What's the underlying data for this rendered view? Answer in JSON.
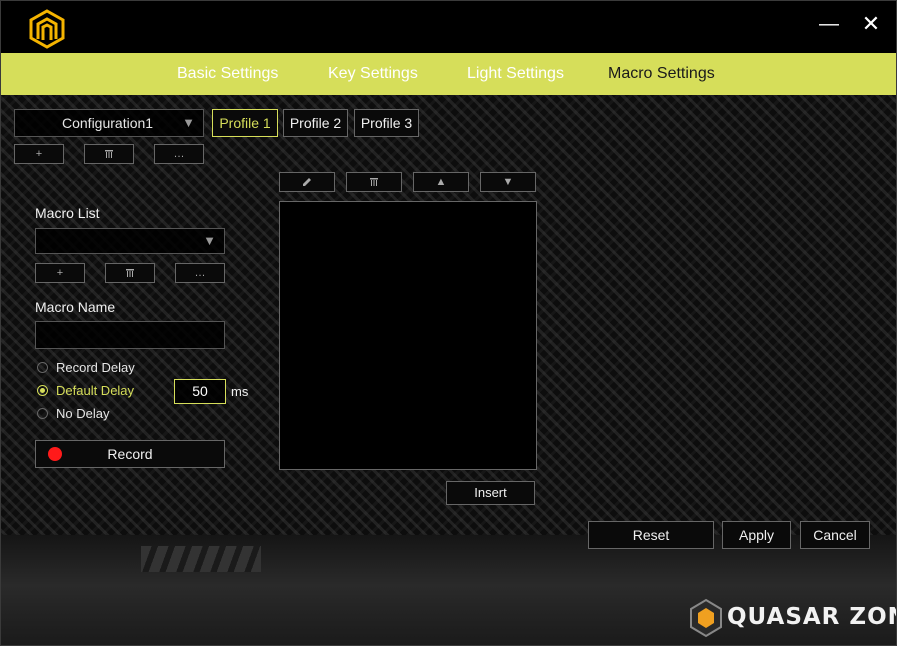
{
  "window": {
    "minimize_glyph": "—",
    "close_glyph": "✕"
  },
  "nav": {
    "tabs": [
      {
        "label": "Basic Settings"
      },
      {
        "label": "Key Settings"
      },
      {
        "label": "Light Settings"
      },
      {
        "label": "Macro Settings",
        "active": true
      }
    ]
  },
  "config": {
    "selected": "Configuration1",
    "arrow": "▼",
    "add": "+",
    "delete_icon": "trash-icon",
    "more": "…"
  },
  "profiles": [
    "Profile 1",
    "Profile 2",
    "Profile 3"
  ],
  "macro_list": {
    "label": "Macro List",
    "selected": "",
    "arrow": "▼",
    "add": "+",
    "more": "…"
  },
  "macro_name": {
    "label": "Macro Name",
    "value": ""
  },
  "delay": {
    "options": [
      "Record Delay",
      "Default Delay",
      "No Delay"
    ],
    "selected": "Default Delay",
    "value": "50",
    "unit": "ms"
  },
  "record": {
    "label": "Record"
  },
  "editor_tools": {
    "edit_icon": "pencil-icon",
    "delete_icon": "trash-icon",
    "up": "▲",
    "down": "▼"
  },
  "insert": {
    "label": "Insert"
  },
  "footer": {
    "reset": "Reset",
    "apply": "Apply",
    "cancel": "Cancel"
  },
  "watermark": {
    "text": "QUASAR ZONE"
  },
  "colors": {
    "accent": "#d6de5a",
    "record_dot": "#ff1a1a",
    "background": "#0b0b0b"
  }
}
